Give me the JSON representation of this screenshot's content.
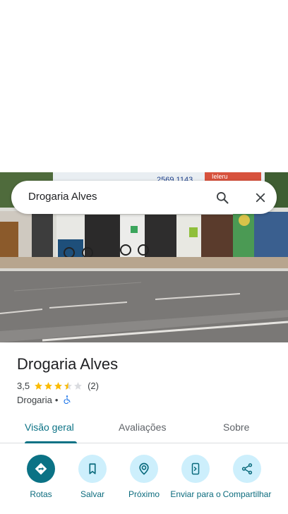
{
  "search": {
    "query": "Drogaria Alves"
  },
  "photo": {
    "sign_text_1": "2569 1143",
    "sign_text_2": "Ieleru"
  },
  "place": {
    "name": "Drogaria Alves",
    "rating": "3,5",
    "rating_stars_value": 3.5,
    "review_count": "(2)",
    "category": "Drogaria",
    "separator": "•"
  },
  "tabs": [
    {
      "label": "Visão geral",
      "active": true
    },
    {
      "label": "Avaliações",
      "active": false
    },
    {
      "label": "Sobre",
      "active": false
    }
  ],
  "actions": [
    {
      "label": "Rotas",
      "icon": "directions-icon"
    },
    {
      "label": "Salvar",
      "icon": "bookmark-icon"
    },
    {
      "label": "Próximo",
      "icon": "nearby-icon"
    },
    {
      "label": "Enviar para o",
      "icon": "send-to-phone-icon"
    },
    {
      "label": "Compartilhar",
      "icon": "share-icon"
    }
  ],
  "colors": {
    "accent": "#0b7285",
    "action_bg": "#cdeffc",
    "star": "#fbbc04",
    "star_empty": "#dadce0"
  }
}
